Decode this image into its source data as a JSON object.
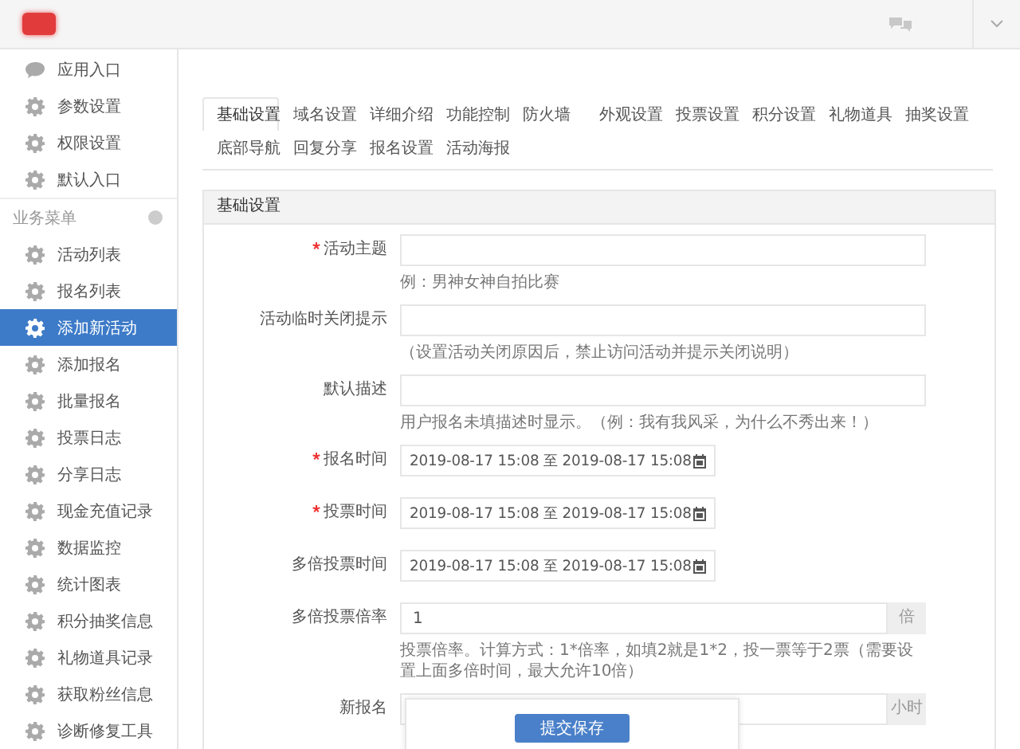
{
  "sidebar": {
    "top_items": [
      {
        "label": "应用入口",
        "selected": false
      },
      {
        "label": "参数设置",
        "selected": false
      },
      {
        "label": "权限设置",
        "selected": false
      },
      {
        "label": "默认入口",
        "selected": false
      }
    ],
    "section": {
      "title": "业务菜单"
    },
    "items": [
      {
        "label": "活动列表",
        "selected": false
      },
      {
        "label": "报名列表",
        "selected": false
      },
      {
        "label": "添加新活动",
        "selected": true
      },
      {
        "label": "添加报名",
        "selected": false
      },
      {
        "label": "批量报名",
        "selected": false
      },
      {
        "label": "投票日志",
        "selected": false
      },
      {
        "label": "分享日志",
        "selected": false
      },
      {
        "label": "现金充值记录",
        "selected": false
      },
      {
        "label": "数据监控",
        "selected": false
      },
      {
        "label": "统计图表",
        "selected": false
      },
      {
        "label": "积分抽奖信息",
        "selected": false
      },
      {
        "label": "礼物道具记录",
        "selected": false
      },
      {
        "label": "获取粉丝信息",
        "selected": false
      },
      {
        "label": "诊断修复工具",
        "selected": false
      }
    ]
  },
  "tabs": [
    {
      "label": "基础设置",
      "selected": true
    },
    {
      "label": "域名设置",
      "selected": false
    },
    {
      "label": "详细介绍",
      "selected": false
    },
    {
      "label": "功能控制",
      "selected": false
    },
    {
      "label": "防火墙",
      "selected": false
    },
    {
      "label": "外观设置",
      "selected": false
    },
    {
      "label": "投票设置",
      "selected": false
    },
    {
      "label": "积分设置",
      "selected": false
    },
    {
      "label": "礼物道具",
      "selected": false
    },
    {
      "label": "抽奖设置",
      "selected": false
    },
    {
      "label": "底部导航",
      "selected": false
    },
    {
      "label": "回复分享",
      "selected": false
    },
    {
      "label": "报名设置",
      "selected": false
    },
    {
      "label": "活动海报",
      "selected": false
    }
  ],
  "panel": {
    "title": "基础设置",
    "fields": [
      {
        "kind": "text",
        "label": "活动主题",
        "required": true,
        "hint": "例：男神女神自拍比赛"
      },
      {
        "kind": "text",
        "label": "活动临时关闭提示",
        "required": false,
        "hint": "（设置活动关闭原因后，禁止访问活动并提示关闭说明）"
      },
      {
        "kind": "text",
        "label": "默认描述",
        "required": false,
        "hint": "用户报名未填描述时显示。（例：我有我风采，为什么不秀出来！）"
      },
      {
        "kind": "daterange",
        "label": "报名时间",
        "required": true,
        "value": "2019-08-17 15:08 至 2019-08-17 15:08"
      },
      {
        "kind": "daterange",
        "label": "投票时间",
        "required": true,
        "value": "2019-08-17 15:08 至 2019-08-17 15:08"
      },
      {
        "kind": "daterange",
        "label": "多倍投票时间",
        "required": false,
        "value": "2019-08-17 15:08 至 2019-08-17 15:08"
      },
      {
        "kind": "addon",
        "label": "多倍投票倍率",
        "required": false,
        "value": "1",
        "addon": "倍",
        "hint": "投票倍率。计算方式：1*倍率，如填2就是1*2，投一票等于2票（需要设置上面多倍时间，最大允许10倍）"
      },
      {
        "kind": "addon",
        "label": "新报名",
        "required": false,
        "addon": "小时"
      }
    ]
  },
  "save_button": "提交保存"
}
